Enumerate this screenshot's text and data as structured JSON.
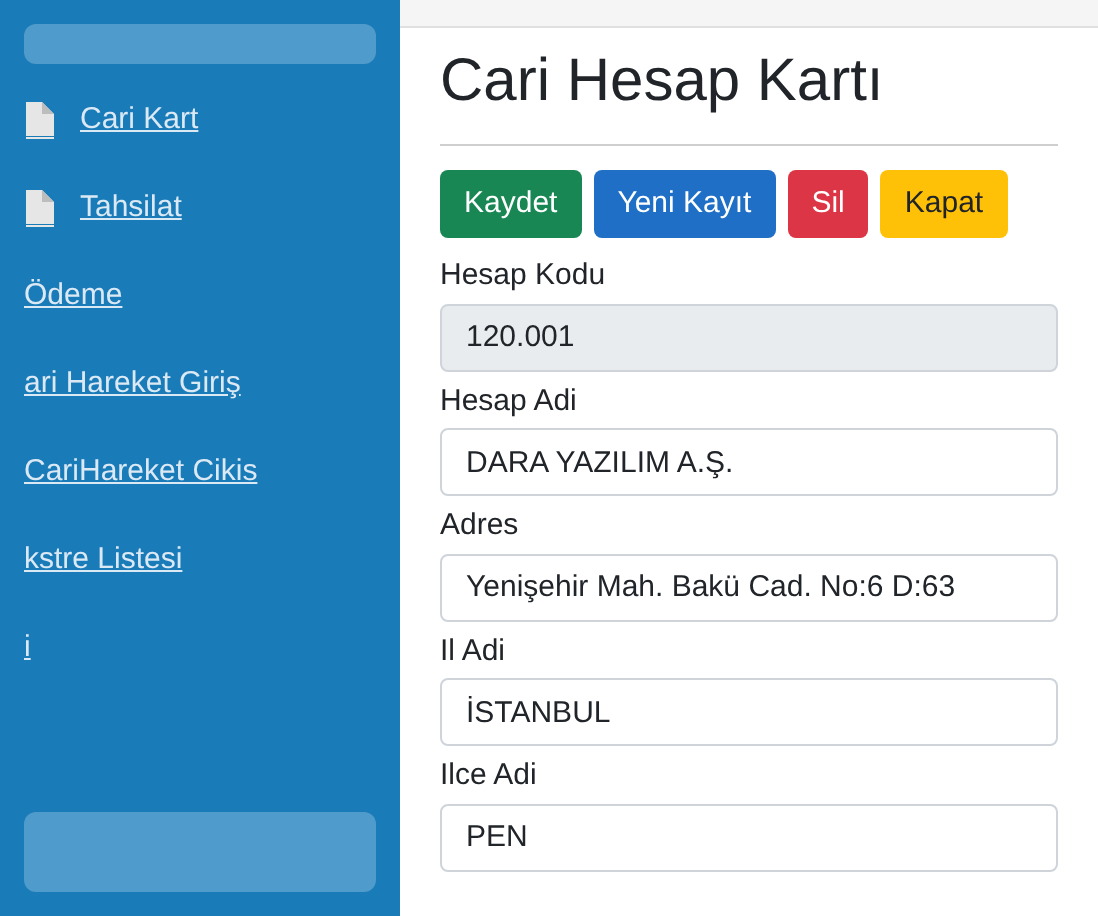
{
  "sidebar": {
    "items": [
      {
        "label": "Cari Kart",
        "icon": true
      },
      {
        "label": "Tahsilat",
        "icon": true
      },
      {
        "label": "Ödeme",
        "icon": false
      },
      {
        "label": "ari Hareket Giriş",
        "icon": false
      },
      {
        "label": "CariHareket Cikis",
        "icon": false
      },
      {
        "label": "kstre Listesi",
        "icon": false
      },
      {
        "label": "i",
        "icon": false
      }
    ]
  },
  "page": {
    "title": "Cari Hesap Kartı",
    "buttons": [
      {
        "label": "Kaydet",
        "kind": "success"
      },
      {
        "label": "Yeni Kayıt",
        "kind": "primary"
      },
      {
        "label": "Sil",
        "kind": "danger"
      },
      {
        "label": "Kapat",
        "kind": "warning"
      }
    ],
    "fields": [
      {
        "label": "Hesap Kodu",
        "value": "120.001",
        "disabled": true
      },
      {
        "label": "Hesap Adi",
        "value": "DARA YAZILIM A.Ş.",
        "disabled": false
      },
      {
        "label": "Adres",
        "value": "Yenişehir Mah. Bakü Cad. No:6 D:63",
        "disabled": false
      },
      {
        "label": "Il Adi",
        "value": "İSTANBUL",
        "disabled": false
      },
      {
        "label": "Ilce Adi",
        "value": "PEN",
        "disabled": false
      }
    ]
  }
}
